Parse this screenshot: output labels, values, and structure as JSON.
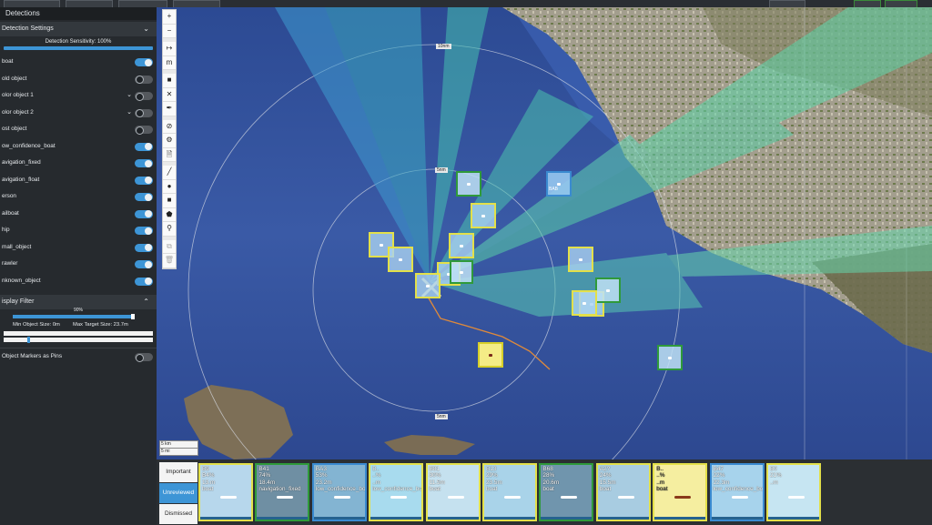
{
  "sidebar": {
    "panel_title": "Detections",
    "settings_title": "Detection Settings",
    "sensitivity_label": "Detection Sensitivity: 100%",
    "classes": [
      {
        "label": "boat",
        "on": true
      },
      {
        "label": "old object",
        "on": false
      },
      {
        "label": "olor object 1",
        "on": false,
        "dropdown": true
      },
      {
        "label": "olor object 2",
        "on": false,
        "dropdown": true
      },
      {
        "label": "ost object",
        "on": false
      },
      {
        "label": "ow_confidence_boat",
        "on": true
      },
      {
        "label": "avigation_fixed",
        "on": true
      },
      {
        "label": "avigation_float",
        "on": true
      },
      {
        "label": "erson",
        "on": true
      },
      {
        "label": "ailboat",
        "on": true
      },
      {
        "label": "hip",
        "on": true
      },
      {
        "label": "mall_object",
        "on": true
      },
      {
        "label": "rawler",
        "on": true
      },
      {
        "label": "nknown_object",
        "on": true
      }
    ],
    "display_filter_label": "isplay Filter",
    "display_filter_value": "90%",
    "display_filter_fraction": 0.9,
    "min_size_label": "Min Object Size: 0m",
    "max_size_label": "Max Target Size: 23.7m",
    "pins_label": "Object Markers as Pins",
    "pins_on": false
  },
  "map": {
    "ring_labels": [
      "10nm",
      "5nm",
      "5nm"
    ],
    "scale_labels": [
      "5 km",
      "5 mi"
    ],
    "toolbar_icons": [
      "zoom-in-icon",
      "zoom-out-icon",
      "measure-icon",
      "units-icon",
      "square-icon",
      "close-icon",
      "pen-icon",
      "no-icon",
      "settings-icon",
      "document-icon",
      "line-icon",
      "circle-icon",
      "rectangle-icon",
      "polygon-icon",
      "pin-icon",
      "copy-icon",
      "trash-icon"
    ],
    "toolbar_glyphs": [
      "+",
      "−",
      "↦",
      "m",
      "■",
      "✕",
      "✒",
      "⊘",
      "⚙",
      "🗎",
      "╱",
      "●",
      "■",
      "⬟",
      "⚲",
      "⧉",
      "🗑"
    ],
    "detections": [
      {
        "style": "green"
      },
      {
        "style": "yellow"
      },
      {
        "style": "blue",
        "tag": "BAB"
      },
      {
        "style": "yellow"
      },
      {
        "style": "yellow"
      },
      {
        "style": "yellow"
      },
      {
        "style": "yellow"
      },
      {
        "style": "green"
      },
      {
        "style": "yellow"
      },
      {
        "style": "yellow"
      },
      {
        "style": "yellow"
      },
      {
        "style": "green"
      },
      {
        "style": "yellow"
      },
      {
        "style": "yellow-solid"
      },
      {
        "style": "green"
      }
    ]
  },
  "filters": [
    "Important",
    "Unreviewed",
    "Dismissed"
  ],
  "thumbnails": [
    {
      "lines": [
        "B9",
        "B4%",
        "13.m",
        "boat"
      ],
      "bg": "#b7d7ec"
    },
    {
      "lines": [
        "B41",
        "74%",
        "18.4m",
        "navigation_fixed"
      ],
      "bg": "#6f8fa3"
    },
    {
      "lines": [
        "BA3",
        "53%",
        "23.2m",
        "low_confidence_boat"
      ],
      "bg": "#83b4d2"
    },
    {
      "lines": [
        "B..",
        "..%",
        "..m",
        "low_confidence_boat"
      ],
      "bg": "#a8dbee"
    },
    {
      "lines": [
        "B81",
        "30%",
        "11.5m",
        "boat"
      ],
      "bg": "#c5e1ef"
    },
    {
      "lines": [
        "B13",
        "29%",
        "23.5m",
        "boat"
      ],
      "bg": "#a9d3e9"
    },
    {
      "lines": [
        "B68",
        "28%",
        "20.6m",
        "boat"
      ],
      "bg": "#7095ad"
    },
    {
      "lines": [
        "A2?",
        "24%",
        "15.5m",
        "boat"
      ],
      "bg": "#a8cce1"
    },
    {
      "lines": [
        "B..",
        "..%",
        "..m",
        "boat"
      ],
      "bg": "#f5eea0"
    },
    {
      "lines": [
        "B47",
        "22%",
        "22.3m",
        "low_confidence_boat"
      ],
      "bg": "#a7d3ec"
    },
    {
      "lines": [
        "B0",
        "21%",
        "..m",
        ""
      ],
      "bg": "#c6e5f2"
    }
  ]
}
